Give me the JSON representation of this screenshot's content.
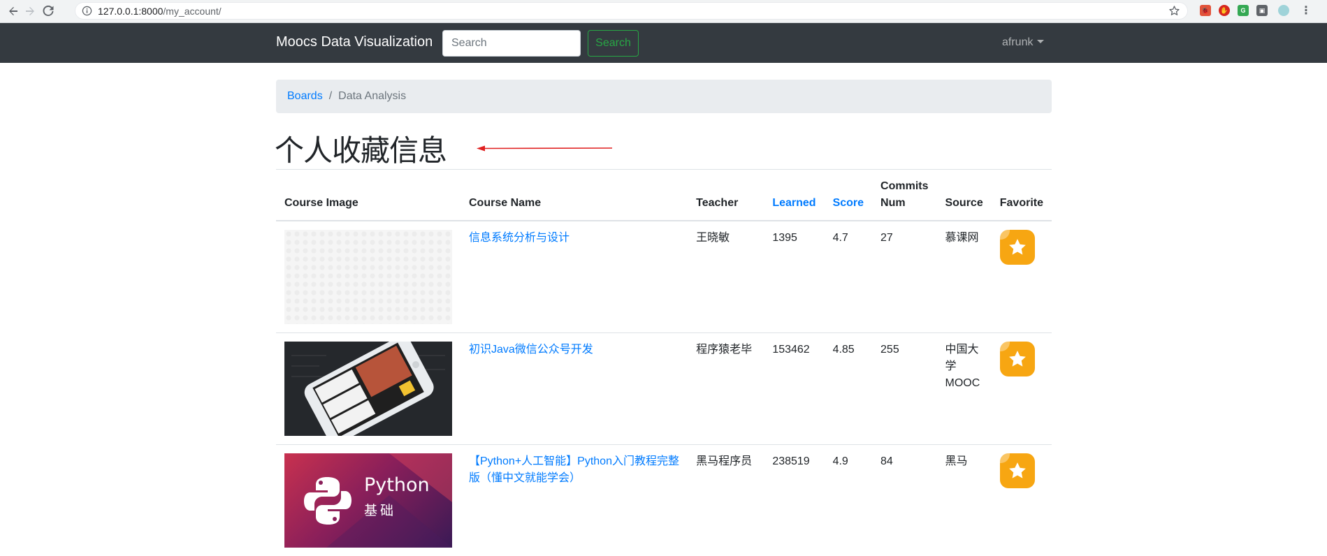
{
  "browser": {
    "url_host": "127.0.0.1:8000",
    "url_path": "/my_account/"
  },
  "navbar": {
    "brand": "Moocs Data Visualization",
    "search_placeholder": "Search",
    "search_button": "Search",
    "username": "afrunk"
  },
  "breadcrumb": {
    "items": [
      "Boards",
      "Data Analysis"
    ]
  },
  "page": {
    "title": "个人收藏信息"
  },
  "table": {
    "headers": {
      "image": "Course Image",
      "name": "Course Name",
      "teacher": "Teacher",
      "learned": "Learned",
      "score": "Score",
      "commits_line1": "Commits",
      "commits_line2": "Num",
      "source": "Source",
      "favorite": "Favorite"
    },
    "rows": [
      {
        "name": "信息系统分析与设计",
        "teacher": "王晓敏",
        "learned": "1395",
        "score": "4.7",
        "commits": "27",
        "source": "慕课网",
        "image": "placeholder-pattern"
      },
      {
        "name": "初识Java微信公众号开发",
        "teacher": "程序猿老毕",
        "learned": "153462",
        "score": "4.85",
        "commits": "255",
        "source": "中国大学MOOC",
        "image": "phone-photo"
      },
      {
        "name": "【Python+人工智能】Python入门教程完整版（懂中文就能学会）",
        "teacher": "黑马程序员",
        "learned": "238519",
        "score": "4.9",
        "commits": "84",
        "source": "黑马",
        "image": "python-logo",
        "image_text_1": "Python",
        "image_text_2": "基础"
      }
    ]
  },
  "colors": {
    "navbar_bg": "#343a40",
    "link": "#007bff",
    "success": "#28a745",
    "favorite": "#f7a612",
    "annotation_arrow": "#e02020"
  }
}
